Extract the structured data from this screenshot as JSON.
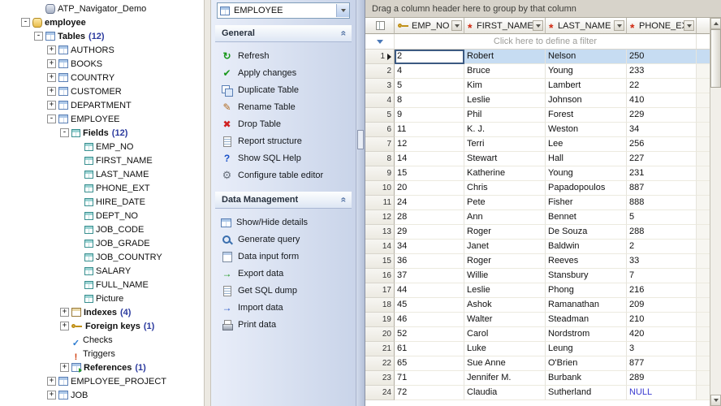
{
  "colors": {
    "selection": "#c6dcf2",
    "null_text": "#3a3ad0",
    "panel_bg": "#d5deee",
    "accent": "#4a78b8"
  },
  "tree": {
    "items": [
      {
        "label": "ATP_Navigator_Demo",
        "level": 2,
        "icon": "server",
        "expand": null,
        "bold": false
      },
      {
        "label": "employee",
        "level": 1,
        "icon": "db",
        "expand": "minus",
        "bold": true
      },
      {
        "label": "Tables",
        "count": 12,
        "level": 2,
        "icon": "table",
        "expand": "minus",
        "bold": true
      },
      {
        "label": "AUTHORS",
        "level": 3,
        "icon": "table",
        "expand": "plus",
        "bold": false
      },
      {
        "label": "BOOKS",
        "level": 3,
        "icon": "table",
        "expand": "plus",
        "bold": false
      },
      {
        "label": "COUNTRY",
        "level": 3,
        "icon": "table",
        "expand": "plus",
        "bold": false
      },
      {
        "label": "CUSTOMER",
        "level": 3,
        "icon": "table",
        "expand": "plus",
        "bold": false
      },
      {
        "label": "DEPARTMENT",
        "level": 3,
        "icon": "table",
        "expand": "plus",
        "bold": false
      },
      {
        "label": "EMPLOYEE",
        "level": 3,
        "icon": "table",
        "expand": "minus",
        "bold": false
      },
      {
        "label": "Fields",
        "count": 12,
        "level": 4,
        "icon": "fields",
        "expand": "minus",
        "bold": true
      },
      {
        "label": "EMP_NO",
        "level": 5,
        "icon": "field",
        "expand": null,
        "bold": false
      },
      {
        "label": "FIRST_NAME",
        "level": 5,
        "icon": "field",
        "expand": null,
        "bold": false
      },
      {
        "label": "LAST_NAME",
        "level": 5,
        "icon": "field",
        "expand": null,
        "bold": false
      },
      {
        "label": "PHONE_EXT",
        "level": 5,
        "icon": "field",
        "expand": null,
        "bold": false
      },
      {
        "label": "HIRE_DATE",
        "level": 5,
        "icon": "field",
        "expand": null,
        "bold": false
      },
      {
        "label": "DEPT_NO",
        "level": 5,
        "icon": "field",
        "expand": null,
        "bold": false
      },
      {
        "label": "JOB_CODE",
        "level": 5,
        "icon": "field",
        "expand": null,
        "bold": false
      },
      {
        "label": "JOB_GRADE",
        "level": 5,
        "icon": "field",
        "expand": null,
        "bold": false
      },
      {
        "label": "JOB_COUNTRY",
        "level": 5,
        "icon": "field",
        "expand": null,
        "bold": false
      },
      {
        "label": "SALARY",
        "level": 5,
        "icon": "field",
        "expand": null,
        "bold": false
      },
      {
        "label": "FULL_NAME",
        "level": 5,
        "icon": "field",
        "expand": null,
        "bold": false
      },
      {
        "label": "Picture",
        "level": 5,
        "icon": "field",
        "expand": null,
        "bold": false
      },
      {
        "label": "Indexes",
        "count": 4,
        "level": 4,
        "icon": "index",
        "expand": "plus",
        "bold": true
      },
      {
        "label": "Foreign keys",
        "count": 1,
        "level": 4,
        "icon": "fkey",
        "expand": "plus",
        "bold": true
      },
      {
        "label": "Checks",
        "level": 4,
        "icon": "check",
        "expand": null,
        "bold": false
      },
      {
        "label": "Triggers",
        "level": 4,
        "icon": "trigger",
        "expand": null,
        "bold": false
      },
      {
        "label": "References",
        "count": 1,
        "level": 4,
        "icon": "ref",
        "expand": "plus",
        "bold": true
      },
      {
        "label": "EMPLOYEE_PROJECT",
        "level": 3,
        "icon": "table",
        "expand": "plus",
        "bold": false
      },
      {
        "label": "JOB",
        "level": 3,
        "icon": "table",
        "expand": "plus",
        "bold": false
      }
    ]
  },
  "panel": {
    "selector_value": "EMPLOYEE",
    "sections": [
      {
        "title": "General",
        "items": [
          {
            "label": "Refresh",
            "icon": "refresh"
          },
          {
            "label": "Apply changes",
            "icon": "check"
          },
          {
            "label": "Duplicate Table",
            "icon": "dup"
          },
          {
            "label": "Rename Table",
            "icon": "pencil"
          },
          {
            "label": "Drop Table",
            "icon": "cross"
          },
          {
            "label": "Report structure",
            "icon": "doc"
          },
          {
            "label": "Show SQL Help",
            "icon": "help"
          },
          {
            "label": "Configure table editor",
            "icon": "gear"
          }
        ]
      },
      {
        "title": "Data Management",
        "items": [
          {
            "label": "Show/Hide details",
            "icon": "tbl"
          },
          {
            "label": "Generate query",
            "icon": "query"
          },
          {
            "label": "Data input form",
            "icon": "form"
          },
          {
            "label": "Export data",
            "icon": "out"
          },
          {
            "label": "Get SQL dump",
            "icon": "doc"
          },
          {
            "label": "Import data",
            "icon": "in"
          },
          {
            "label": "Print data",
            "icon": "print"
          }
        ]
      }
    ]
  },
  "grid": {
    "group_hint": "Drag a column header here to group by that column",
    "filter_hint": "Click here to define a filter",
    "columns": [
      {
        "label": "EMP_NO",
        "icon": "key"
      },
      {
        "label": "FIRST_NAME",
        "icon": "asterisk"
      },
      {
        "label": "LAST_NAME",
        "icon": "asterisk"
      },
      {
        "label": "PHONE_EXT",
        "icon": "asterisk"
      }
    ],
    "selected_row": 0,
    "rows": [
      [
        "2",
        "Robert",
        "Nelson",
        "250"
      ],
      [
        "4",
        "Bruce",
        "Young",
        "233"
      ],
      [
        "5",
        "Kim",
        "Lambert",
        "22"
      ],
      [
        "8",
        "Leslie",
        "Johnson",
        "410"
      ],
      [
        "9",
        "Phil",
        "Forest",
        "229"
      ],
      [
        "11",
        "K. J.",
        "Weston",
        "34"
      ],
      [
        "12",
        "Terri",
        "Lee",
        "256"
      ],
      [
        "14",
        "Stewart",
        "Hall",
        "227"
      ],
      [
        "15",
        "Katherine",
        "Young",
        "231"
      ],
      [
        "20",
        "Chris",
        "Papadopoulos",
        "887"
      ],
      [
        "24",
        "Pete",
        "Fisher",
        "888"
      ],
      [
        "28",
        "Ann",
        "Bennet",
        "5"
      ],
      [
        "29",
        "Roger",
        "De Souza",
        "288"
      ],
      [
        "34",
        "Janet",
        "Baldwin",
        "2"
      ],
      [
        "36",
        "Roger",
        "Reeves",
        "33"
      ],
      [
        "37",
        "Willie",
        "Stansbury",
        "7"
      ],
      [
        "44",
        "Leslie",
        "Phong",
        "216"
      ],
      [
        "45",
        "Ashok",
        "Ramanathan",
        "209"
      ],
      [
        "46",
        "Walter",
        "Steadman",
        "210"
      ],
      [
        "52",
        "Carol",
        "Nordstrom",
        "420"
      ],
      [
        "61",
        "Luke",
        "Leung",
        "3"
      ],
      [
        "65",
        "Sue Anne",
        "O'Brien",
        "877"
      ],
      [
        "71",
        "Jennifer M.",
        "Burbank",
        "289"
      ],
      [
        "72",
        "Claudia",
        "Sutherland",
        "NULL"
      ]
    ]
  }
}
